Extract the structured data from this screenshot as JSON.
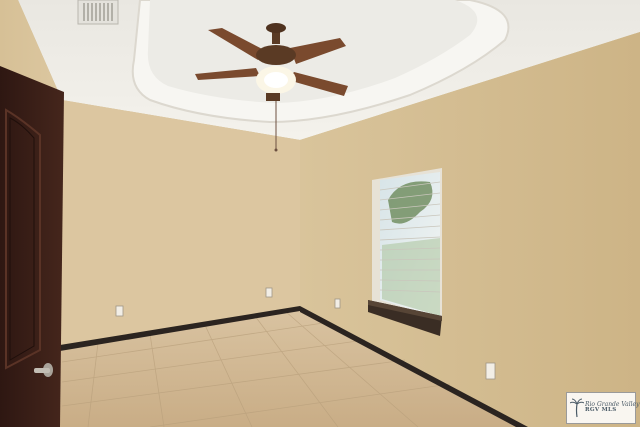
{
  "scene": {
    "description_colors": {
      "wall_left": "#d9c49a",
      "wall_right": "#d3bd8f",
      "ceiling": "#f1efe9",
      "floor": "#cfb693",
      "baseboard": "#2b2420",
      "door": "#3a1f17",
      "fan_blade": "#7a4a2e"
    },
    "icons": [
      "ceiling-fan-icon",
      "palm-tree-icon"
    ]
  },
  "watermark": {
    "line1": "Rio Grande Valley",
    "line2": "RGV MLS"
  }
}
